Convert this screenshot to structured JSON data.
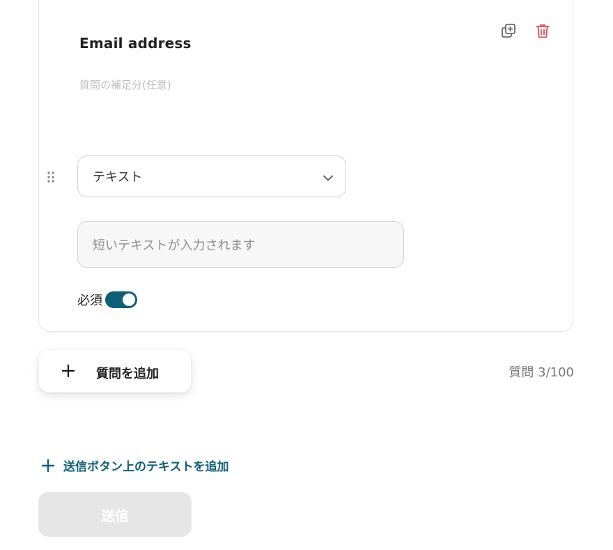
{
  "question": {
    "title": "Email address",
    "description_placeholder": "質問の補足分(任意)",
    "type_value": "テキスト",
    "answer_placeholder": "短いテキストが入力されます",
    "required_label": "必須",
    "required_on": true
  },
  "actions": {
    "duplicate_icon": "duplicate-icon",
    "delete_icon": "trash-icon"
  },
  "footer": {
    "add_question_label": "質問を追加",
    "question_count": "質問 3/100",
    "add_submit_text_label": "送信ボタン上のテキストを追加",
    "submit_label": "送信"
  },
  "colors": {
    "accent": "#0e5f78",
    "danger": "#e5484d",
    "disabled": "#e6e6e6"
  }
}
